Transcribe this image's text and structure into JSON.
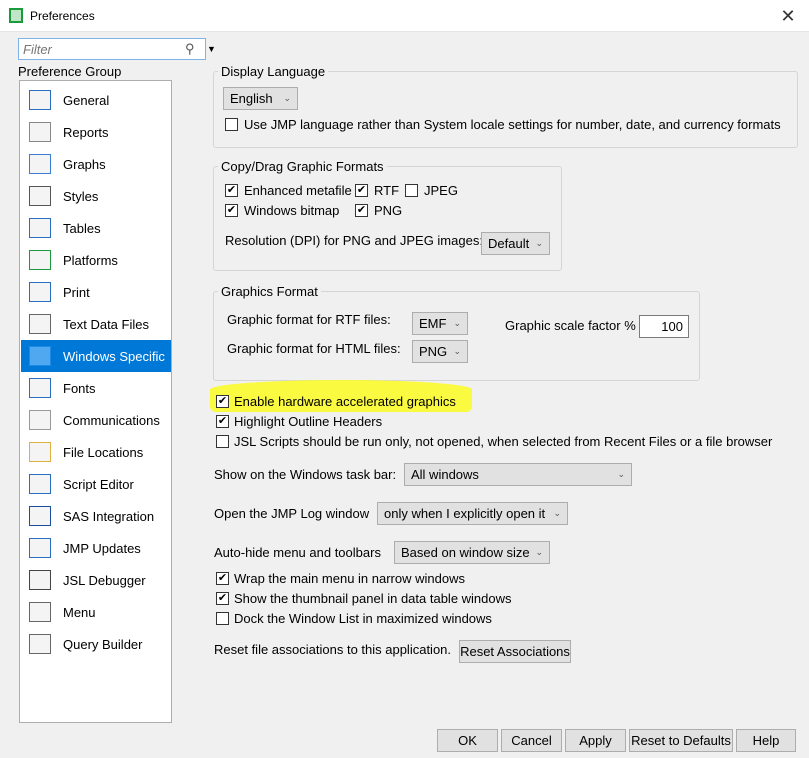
{
  "window": {
    "title": "Preferences",
    "close": "✕"
  },
  "filter": {
    "placeholder": "Filter"
  },
  "sidebar": {
    "label": "Preference Group",
    "selected": "Windows Specific",
    "items": [
      {
        "label": "General",
        "icon": "general-icon"
      },
      {
        "label": "Reports",
        "icon": "reports-icon"
      },
      {
        "label": "Graphs",
        "icon": "graphs-icon"
      },
      {
        "label": "Styles",
        "icon": "styles-icon"
      },
      {
        "label": "Tables",
        "icon": "tables-icon"
      },
      {
        "label": "Platforms",
        "icon": "platforms-icon"
      },
      {
        "label": "Print",
        "icon": "print-icon"
      },
      {
        "label": "Text Data Files",
        "icon": "text-data-icon"
      },
      {
        "label": "Windows Specific",
        "icon": "monitor-icon"
      },
      {
        "label": "Fonts",
        "icon": "fonts-icon"
      },
      {
        "label": "Communications",
        "icon": "communications-icon"
      },
      {
        "label": "File Locations",
        "icon": "folder-icon"
      },
      {
        "label": "Script Editor",
        "icon": "script-editor-icon"
      },
      {
        "label": "SAS Integration",
        "icon": "sas-icon"
      },
      {
        "label": "JMP Updates",
        "icon": "updates-icon"
      },
      {
        "label": "JSL Debugger",
        "icon": "wrench-icon"
      },
      {
        "label": "Menu",
        "icon": "menu-icon"
      },
      {
        "label": "Query Builder",
        "icon": "database-icon"
      }
    ]
  },
  "display_language": {
    "title": "Display Language",
    "language": "English",
    "use_jmp_locale": {
      "label": "Use JMP language rather than System locale settings for number, date, and currency formats",
      "checked": false
    }
  },
  "copy_drag": {
    "title": "Copy/Drag Graphic Formats",
    "formats": [
      {
        "label": "Enhanced metafile",
        "checked": true
      },
      {
        "label": "RTF",
        "checked": true
      },
      {
        "label": "JPEG",
        "checked": false
      },
      {
        "label": "Windows bitmap",
        "checked": true
      },
      {
        "label": "PNG",
        "checked": true
      }
    ],
    "resolution_label": "Resolution (DPI) for PNG and JPEG images:",
    "resolution": "Default"
  },
  "graphics_format": {
    "title": "Graphics Format",
    "rtf_label": "Graphic format for RTF files:",
    "rtf": "EMF",
    "html_label": "Graphic format for HTML files:",
    "html": "PNG",
    "scale_label": "Graphic scale factor %",
    "scale": "100"
  },
  "options": [
    {
      "label": "Enable hardware accelerated graphics",
      "checked": true
    },
    {
      "label": "Highlight Outline Headers",
      "checked": true
    },
    {
      "label": "JSL Scripts should be run only, not opened, when selected from Recent Files or a file browser",
      "checked": false
    }
  ],
  "taskbar": {
    "label": "Show on the Windows task bar:",
    "value": "All windows"
  },
  "log": {
    "label": "Open the JMP Log window",
    "value": "only when I explicitly open it"
  },
  "autohide": {
    "label": "Auto-hide menu and toolbars",
    "value": "Based on window size"
  },
  "options2": [
    {
      "label": "Wrap the main menu in narrow windows",
      "checked": true
    },
    {
      "label": "Show the thumbnail panel in data table windows",
      "checked": true
    },
    {
      "label": "Dock the Window List in maximized windows",
      "checked": false
    }
  ],
  "reset": {
    "label": "Reset file associations to this application.",
    "button": "Reset Associations"
  },
  "footer": {
    "ok": "OK",
    "cancel": "Cancel",
    "apply": "Apply",
    "reset_defaults": "Reset to Defaults",
    "help": "Help"
  },
  "colors": {
    "accent": "#0078d7",
    "highlight": "#fbfb2e"
  }
}
